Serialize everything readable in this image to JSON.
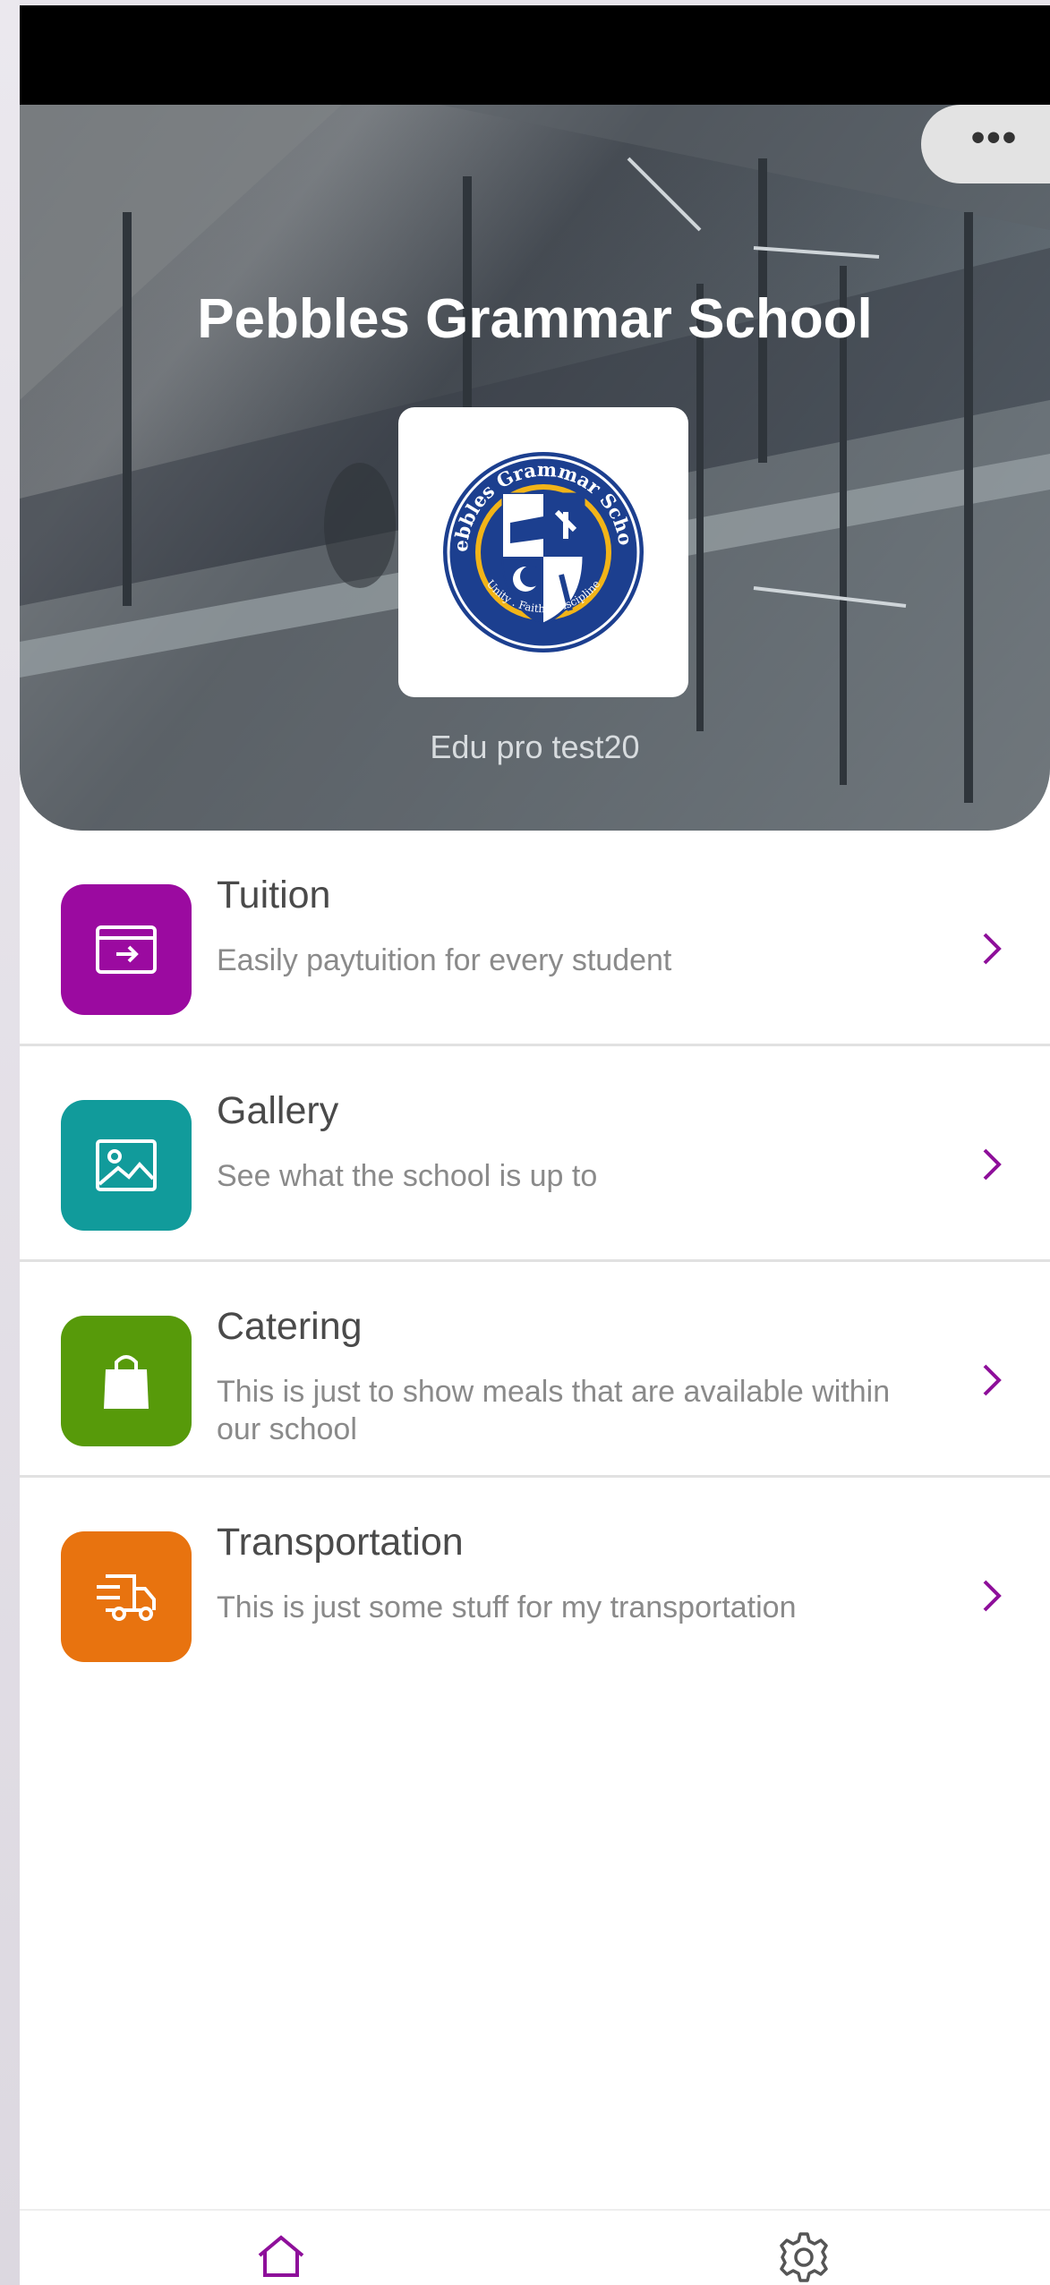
{
  "header": {
    "school_name": "Pebbles Grammar School",
    "subtitle": "Edu pro test20",
    "more_icon": "more-horizontal-icon"
  },
  "logo": {
    "ring_text": "Pebbles Grammar School",
    "motto": "Unity . Faith . Discipline"
  },
  "colors": {
    "accent": "#8e0f9a",
    "tuition": "#9b0aa0",
    "gallery": "#119b9b",
    "catering": "#579a0a",
    "transportation": "#e8730f"
  },
  "menu": [
    {
      "title": "Tuition",
      "description": "Easily paytuition for every student",
      "icon": "payment-card-icon"
    },
    {
      "title": "Gallery",
      "description": "See what the school is up to",
      "icon": "image-icon"
    },
    {
      "title": "Catering",
      "description": "This is just to show meals that are available within our school",
      "icon": "shopping-bag-icon"
    },
    {
      "title": "Transportation",
      "description": "This is just some stuff for my transportation",
      "icon": "delivery-truck-icon"
    }
  ],
  "bottom_nav": [
    {
      "icon": "home-icon",
      "active": true
    },
    {
      "icon": "settings-gear-icon",
      "active": false
    }
  ]
}
